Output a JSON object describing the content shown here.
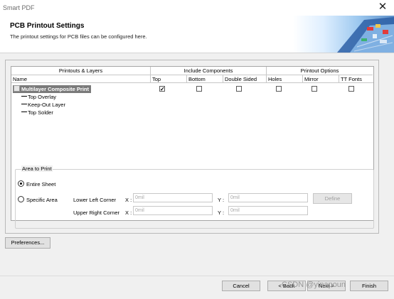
{
  "window": {
    "title": "Smart PDF",
    "close_glyph": "✕"
  },
  "header": {
    "title": "PCB Printout Settings",
    "subtitle": "The printout settings for PCB files can be configured here."
  },
  "grid": {
    "groups": [
      "Printouts & Layers",
      "Include Components",
      "Printout Options"
    ],
    "columns": [
      "Name",
      "Top",
      "Bottom",
      "Double Sided",
      "Holes",
      "Mirror",
      "TT Fonts"
    ],
    "rows": [
      {
        "name": "Multilayer Composite Print",
        "checks": [
          true,
          false,
          false,
          false,
          false,
          false
        ]
      },
      {
        "name": "Top Overlay"
      },
      {
        "name": "Keep-Out Layer"
      },
      {
        "name": "Top Solder"
      }
    ]
  },
  "area_to_print": {
    "title": "Area to Print",
    "entire_sheet": "Entire Sheet",
    "specific_area": "Specific Area",
    "selected": "entire_sheet",
    "lower_left": {
      "label": "Lower Left Corner",
      "x_label": "X :",
      "x_value": "0mil",
      "y_label": "Y :",
      "y_value": "0mil"
    },
    "upper_right": {
      "label": "Upper Right Corner",
      "x_label": "X :",
      "x_value": "0mil",
      "y_label": "Y :",
      "y_value": "0mil"
    },
    "define_label": "Define"
  },
  "buttons": {
    "preferences": "Preferences...",
    "cancel": "Cancel",
    "back": "< Back",
    "next": "Next >",
    "finish": "Finish"
  },
  "watermark": "CSDN @yinapoun",
  "icons": {
    "close": "close-icon",
    "tree": "tree-node-icon",
    "check": "check-icon"
  },
  "colors": {
    "selected_row": "#7a7a7a",
    "hero_blue": "#5c8fc9"
  }
}
